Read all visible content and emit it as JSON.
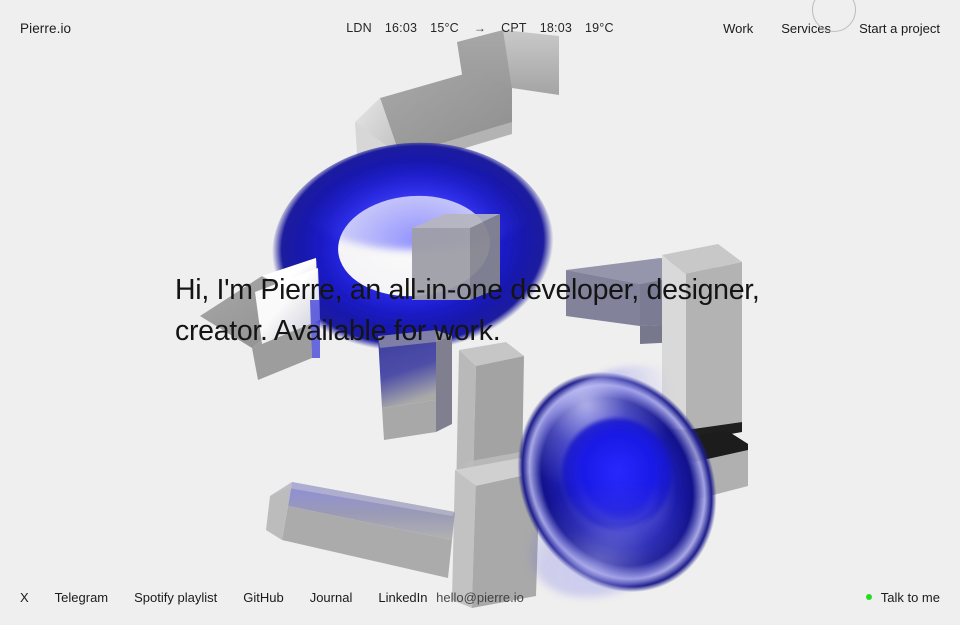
{
  "header": {
    "brand": "Pierre.io",
    "ticker": {
      "from_city": "LDN",
      "from_time": "16:03",
      "from_temp": "15°C",
      "arrow": "→",
      "to_city": "CPT",
      "to_time": "18:03",
      "to_temp": "19°C"
    },
    "nav": [
      {
        "label": "Work"
      },
      {
        "label": "Services"
      },
      {
        "label": "Start a project"
      }
    ],
    "cursor_ring": "hover-ring-indicator"
  },
  "main": {
    "headline": "Hi, I'm Pierre, an all-in-one developer, designer, creator. Available for work."
  },
  "footer": {
    "social_links": [
      {
        "label": "X"
      },
      {
        "label": "Telegram"
      },
      {
        "label": "Spotify playlist"
      },
      {
        "label": "GitHub"
      },
      {
        "label": "Journal"
      },
      {
        "label": "LinkedIn"
      }
    ],
    "email": "hello@pierre.io",
    "cta_label": "Talk to me",
    "status_color": "#23dd23"
  },
  "scene": {
    "description": "3d-abstract-composition",
    "background_color": "#efefef",
    "torus_color": "#1a1ae0",
    "torus_deep_color": "#0e0e8c",
    "box_color": "#9a9a9a",
    "box_light_color": "#d3d3d3",
    "box_reflection_color": "#8f8fd0"
  }
}
